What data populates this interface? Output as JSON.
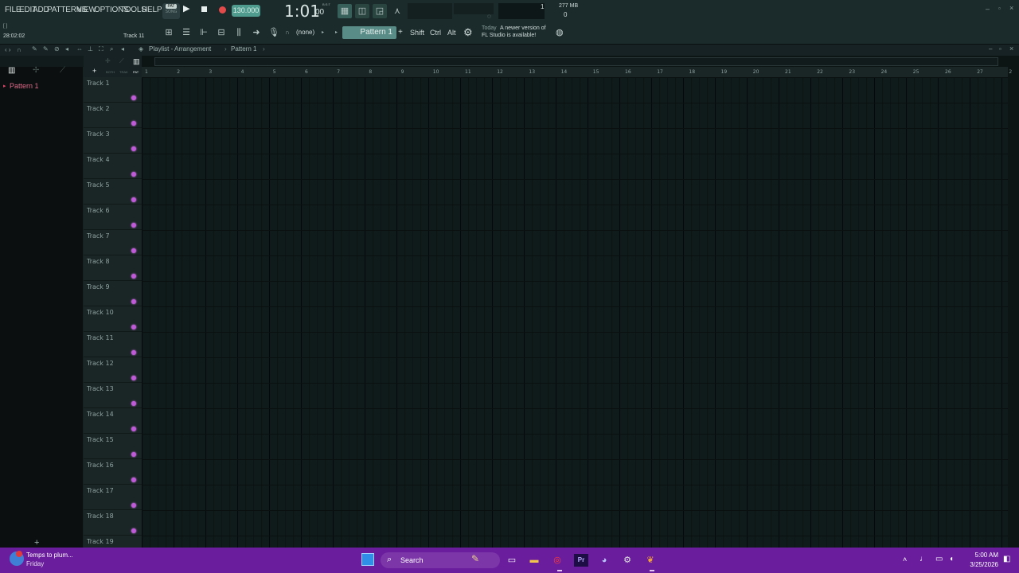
{
  "menu": [
    "FILE",
    "EDIT",
    "ADD",
    "PATTERNS",
    "VIEW",
    "OPTIONS",
    "TOOLS",
    "HELP"
  ],
  "transport": {
    "pat": "PAT",
    "song": "SONG",
    "tempo": "130.000",
    "time": "1:01",
    "time_small": "00",
    "bst": "B:S:T"
  },
  "info": {
    "time": "28:02:02",
    "track": "Track 11",
    "cpu": "1",
    "mem": "277 MB",
    "poly": "0"
  },
  "toolbar": {
    "none": "(none)",
    "pattern": "Pattern 1",
    "shift": "Shift",
    "ctrl": "Ctrl",
    "alt": "Alt",
    "news_date": "Today",
    "news_line1": "A newer version of",
    "news_line2": "FL Studio is available!"
  },
  "playlist": {
    "title": "Playlist - Arrangement",
    "sep": "›",
    "pattern": "Pattern 1",
    "mode_labels": [
      "BOTH",
      "TRAK",
      "PAT"
    ]
  },
  "browser": {
    "pattern_item": "Pattern 1"
  },
  "ruler": [
    "1",
    "2",
    "3",
    "4",
    "5",
    "6",
    "7",
    "8",
    "9",
    "10",
    "11",
    "12",
    "13",
    "14",
    "15",
    "16",
    "17",
    "18",
    "19",
    "20",
    "21",
    "22",
    "23",
    "24",
    "25",
    "26",
    "27",
    "2"
  ],
  "tracks": [
    "Track 1",
    "Track 2",
    "Track 3",
    "Track 4",
    "Track 5",
    "Track 6",
    "Track 7",
    "Track 8",
    "Track 9",
    "Track 10",
    "Track 11",
    "Track 12",
    "Track 13",
    "Track 14",
    "Track 15",
    "Track 16",
    "Track 17",
    "Track 18",
    "Track 19"
  ],
  "taskbar": {
    "weather_line1": "Temps to plum...",
    "weather_line2": "Friday",
    "search": "Search",
    "time": "5:00 AM",
    "date": "3/25/2026"
  }
}
